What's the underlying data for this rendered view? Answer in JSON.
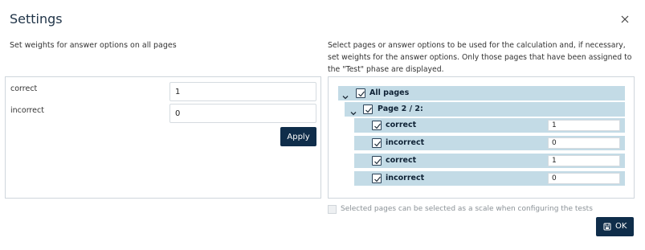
{
  "dialog": {
    "title": "Settings",
    "close_icon": "close-icon"
  },
  "weights": {
    "description": "Set weights for answer options on all pages",
    "rows": [
      {
        "label": "correct",
        "value": "1"
      },
      {
        "label": "incorrect",
        "value": "0"
      }
    ],
    "apply_label": "Apply"
  },
  "selection": {
    "description": "Select pages or answer options to be used for the calculation and, if necessary, set weights for the answer options. Only those pages that have been assigned to the \"Test\" phase are displayed.",
    "tree": {
      "root": {
        "label": "All pages",
        "checked": true,
        "expanded": true
      },
      "page": {
        "label": "Page 2 / 2:",
        "checked": true,
        "expanded": true
      },
      "options": [
        {
          "label": "correct",
          "checked": true,
          "value": "1"
        },
        {
          "label": "incorrect",
          "checked": true,
          "value": "0"
        },
        {
          "label": "correct",
          "checked": true,
          "value": "1"
        },
        {
          "label": "incorrect",
          "checked": true,
          "value": "0"
        }
      ]
    }
  },
  "footer": {
    "scale_checkbox_label": "Selected pages can be selected as a scale when configuring the tests",
    "scale_checked": false,
    "ok_label": "OK",
    "ok_icon": "save-icon"
  },
  "colors": {
    "primary": "#0f2d4a",
    "tree_row": "#c3dbe6",
    "border": "#cfd6dc"
  }
}
